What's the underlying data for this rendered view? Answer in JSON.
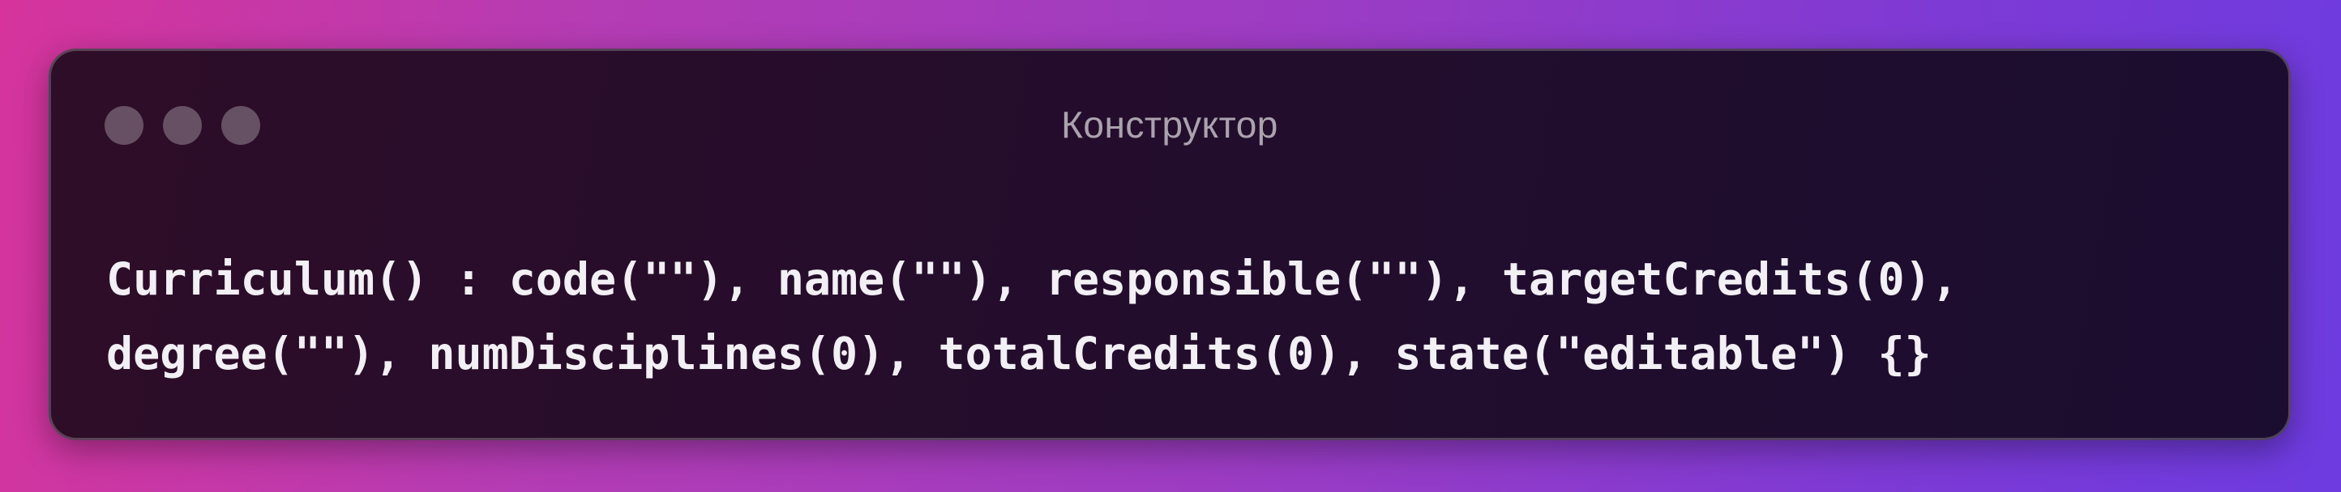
{
  "window": {
    "title": "Конструктор"
  },
  "code": {
    "lines": [
      "Curriculum() : code(\"\"), name(\"\"), responsible(\"\"), targetCredits(0),",
      "degree(\"\"), numDisciplines(0), totalCredits(0), state(\"editable\") {}"
    ]
  },
  "colors": {
    "background_start": "#d6349c",
    "background_end": "#6d3be0",
    "window_bg": "#240d2c",
    "code_text": "#f2eff5",
    "title_text": "#b8a9b8"
  }
}
